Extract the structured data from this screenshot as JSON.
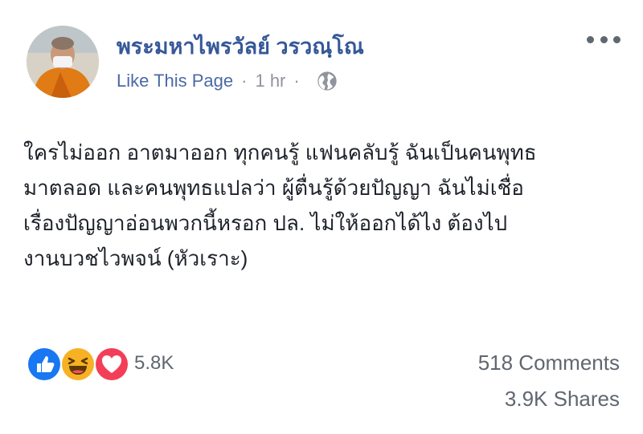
{
  "post": {
    "author": "พระมหาไพรวัลย์ วรวณฺโณ",
    "like_page": "Like This Page",
    "separator": "·",
    "time": "1 hr",
    "privacy_icon": "globe-icon",
    "text_lines": [
      "ใครไม่ออก อาตมาออก ทุกคนรู้ แฟนคลับรู้ ฉันเป็นคนพุทธ",
      "มาตลอด และคนพุทธแปลว่า ผู้ตื่นรู้ด้วยปัญญา ฉันไม่เชื่อ",
      "เรื่องปัญญาอ่อนพวกนี้หรอก ปล. ไม่ให้ออกได้ไง ต้องไป",
      "งานบวชไวพจน์ (หัวเราะ)"
    ]
  },
  "engagement": {
    "reaction_icons": [
      "like-icon",
      "haha-icon",
      "love-icon"
    ],
    "reaction_count": "5.8K",
    "comments": "518 Comments",
    "shares": "3.9K Shares"
  },
  "colors": {
    "link": "#365899",
    "meta": "#90949c",
    "like_blue": "#1877f2",
    "haha_yellow": "#f7b125",
    "love_red": "#f33e58"
  }
}
